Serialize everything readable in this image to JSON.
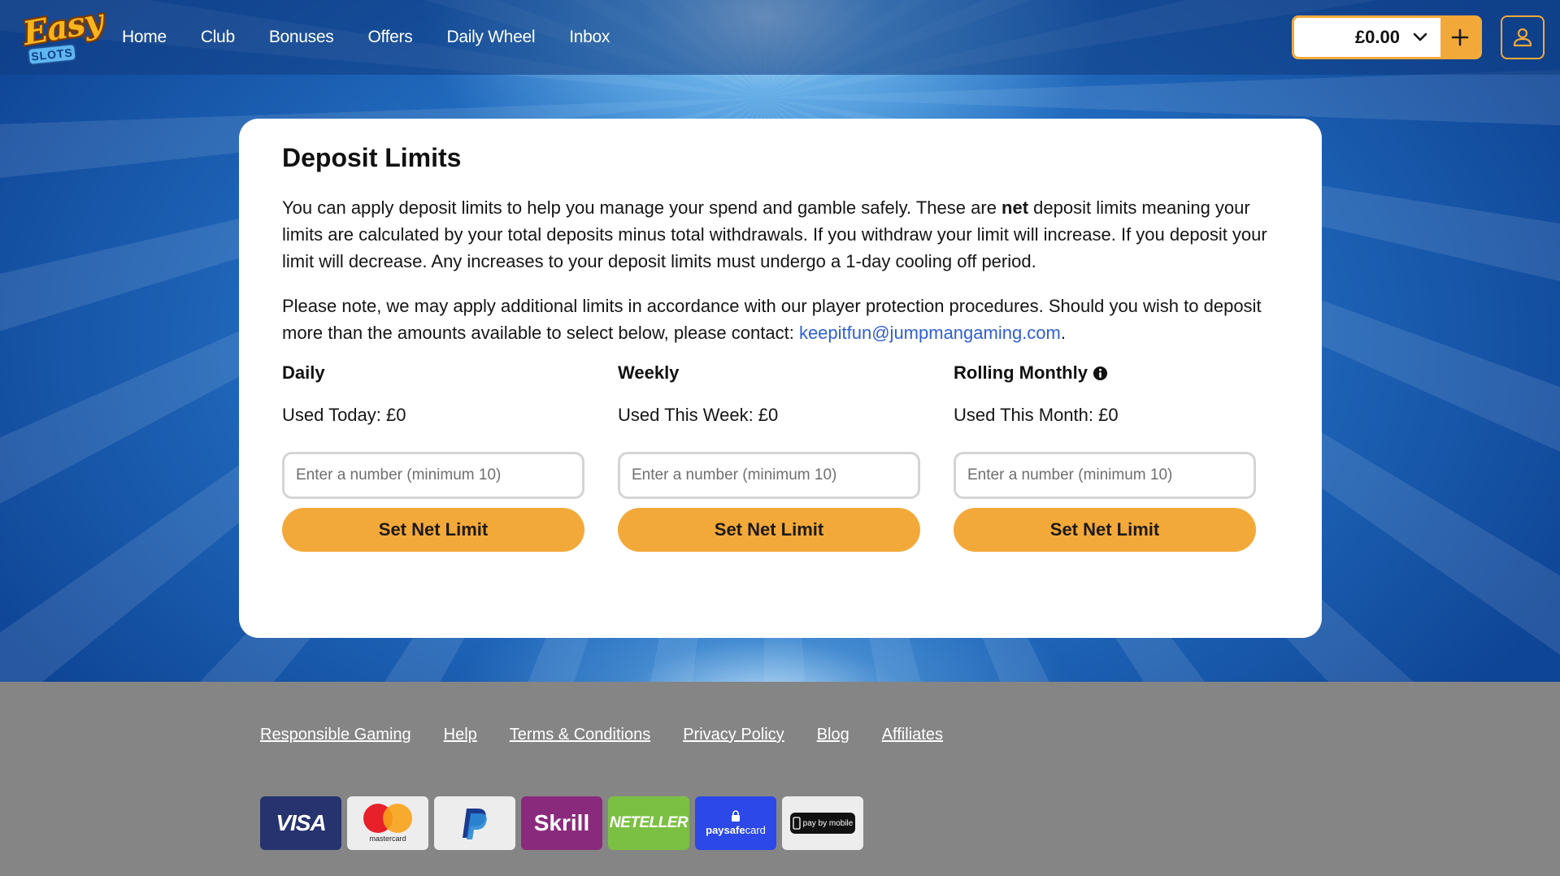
{
  "header": {
    "logo_top": "Easy",
    "logo_bottom": "SLOTS",
    "nav": [
      "Home",
      "Club",
      "Bonuses",
      "Offers",
      "Daily Wheel",
      "Inbox"
    ],
    "balance": "£0.00"
  },
  "card": {
    "title": "Deposit Limits",
    "para1_before": "You can apply deposit limits to help you manage your spend and gamble safely. These are ",
    "para1_bold": "net",
    "para1_after": " deposit limits meaning your limits are calculated by your total deposits minus total withdrawals. If you withdraw your limit will increase. If you deposit your limit will decrease. Any increases to your deposit limits must undergo a 1-day cooling off period.",
    "para2_before": "Please note, we may apply additional limits in accordance with our player protection procedures. Should you wish to deposit more than the amounts available to select below, please contact: ",
    "para2_email": "keepitfun@jumpmangaming.com",
    "para2_after": ".",
    "limits": [
      {
        "title": "Daily",
        "used": "Used Today: £0",
        "placeholder": "Enter a number (minimum 10)",
        "button": "Set Net Limit"
      },
      {
        "title": "Weekly",
        "used": "Used This Week: £0",
        "placeholder": "Enter a number (minimum 10)",
        "button": "Set Net Limit"
      },
      {
        "title": "Rolling Monthly",
        "used": "Used This Month: £0",
        "placeholder": "Enter a number (minimum 10)",
        "button": "Set Net Limit"
      }
    ]
  },
  "footer": {
    "links": [
      "Responsible Gaming",
      "Help",
      "Terms & Conditions",
      "Privacy Policy",
      "Blog",
      "Affiliates"
    ],
    "payments": {
      "visa": "VISA",
      "mastercard": "mastercard",
      "skrill": "Skrill",
      "neteller": "NETELLER",
      "paysafecard_a": "paysafe",
      "paysafecard_b": "card",
      "paybymobile": "pay by mobile"
    }
  },
  "colors": {
    "accent": "#f3a93a",
    "link": "#2f5fd6",
    "footer_bg": "#858585"
  }
}
